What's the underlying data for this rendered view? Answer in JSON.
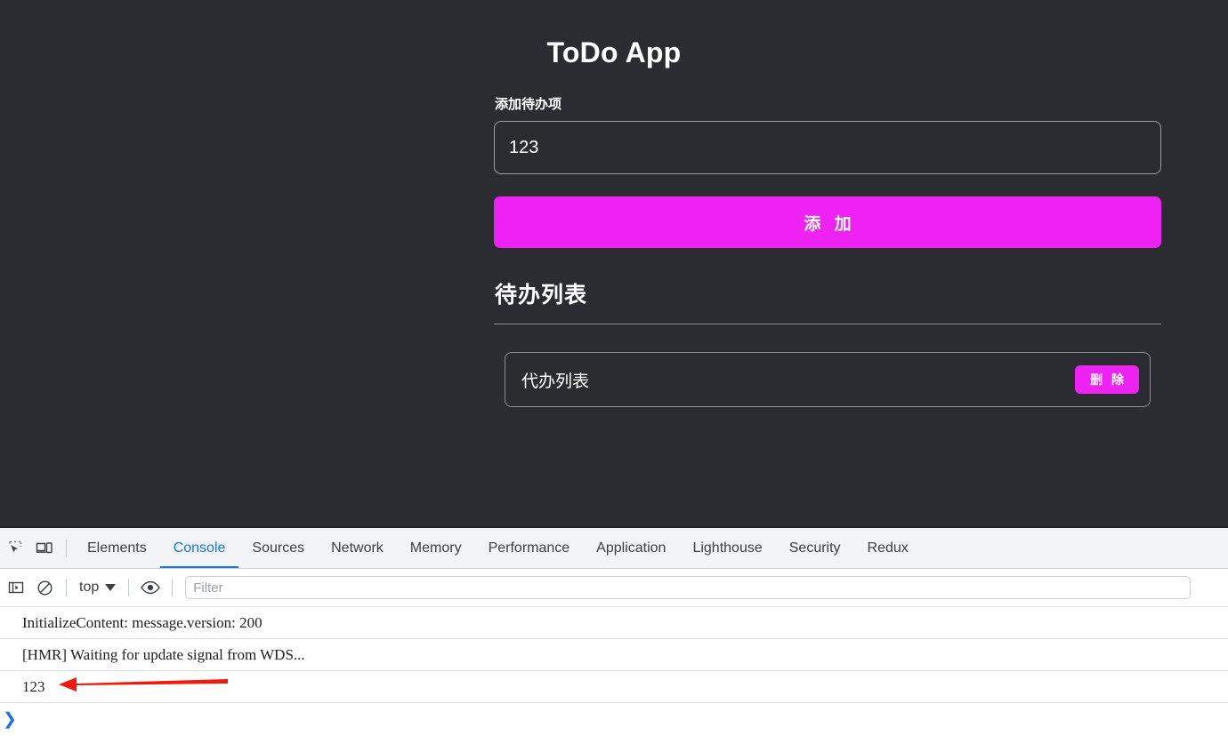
{
  "app": {
    "title": "ToDo App",
    "input_label": "添加待办项",
    "input_value": "123",
    "input_placeholder": "",
    "add_button_label": "添 加",
    "list_heading": "待办列表",
    "items": [
      {
        "text": "代办列表",
        "delete_label": "删 除"
      }
    ],
    "colors": {
      "background": "#2b2c31",
      "accent": "#ee22f2",
      "text": "#ffffff",
      "border": "#8d8f94"
    }
  },
  "devtools": {
    "left_icons": [
      {
        "name": "inspect-element-icon"
      },
      {
        "name": "device-toolbar-icon"
      }
    ],
    "tabs": [
      {
        "label": "Elements",
        "active": false
      },
      {
        "label": "Console",
        "active": true
      },
      {
        "label": "Sources",
        "active": false
      },
      {
        "label": "Network",
        "active": false
      },
      {
        "label": "Memory",
        "active": false
      },
      {
        "label": "Performance",
        "active": false
      },
      {
        "label": "Application",
        "active": false
      },
      {
        "label": "Lighthouse",
        "active": false
      },
      {
        "label": "Security",
        "active": false
      },
      {
        "label": "Redux",
        "active": false
      }
    ],
    "active_tab_color": "#1a73e8",
    "toolbar": {
      "sidebar_toggle_icon": "console-sidebar-icon",
      "clear_console_icon": "clear-console-icon",
      "context_value": "top",
      "eye_icon": "live-expression-eye-icon",
      "filter_placeholder": "Filter",
      "filter_value": ""
    },
    "console_messages": [
      "InitializeContent: message.version: 200",
      "[HMR] Waiting for update signal from WDS...",
      "123"
    ],
    "prompt_symbol": "❯"
  },
  "annotation": {
    "arrow_color": "#ee1c0f",
    "points_to": "123"
  }
}
